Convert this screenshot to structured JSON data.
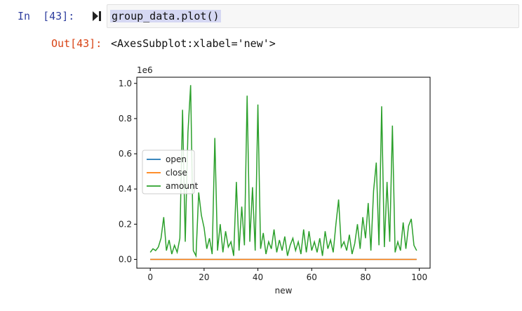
{
  "cell": {
    "in_prompt": "In  [43]:",
    "code": "group_data.plot()",
    "out_prompt": "Out[43]:",
    "output_text": "<AxesSubplot:xlabel='new'>"
  },
  "chart_data": {
    "type": "line",
    "xlabel": "new",
    "ylabel": "",
    "offset_label": "1e6",
    "xlim": [
      -5,
      104
    ],
    "ylim": [
      -0.05,
      1.035
    ],
    "x_ticks": [
      0,
      20,
      40,
      60,
      80,
      100
    ],
    "y_ticks": [
      0.0,
      0.2,
      0.4,
      0.6,
      0.8,
      1.0
    ],
    "x_tick_labels": [
      "0",
      "20",
      "40",
      "60",
      "80",
      "100"
    ],
    "y_tick_labels": [
      "0.0",
      "0.2",
      "0.4",
      "0.6",
      "0.8",
      "1.0"
    ],
    "legend_position": "center-left",
    "series": [
      {
        "name": "open",
        "color": "#1f77b4",
        "values": [
          0,
          0,
          0,
          0,
          0,
          0,
          0,
          0,
          0,
          0,
          0,
          0,
          0,
          0,
          0,
          0,
          0,
          0,
          0,
          0,
          0,
          0,
          0,
          0,
          0,
          0,
          0,
          0,
          0,
          0,
          0,
          0,
          0,
          0,
          0,
          0,
          0,
          0,
          0,
          0,
          0,
          0,
          0,
          0,
          0,
          0,
          0,
          0,
          0,
          0,
          0,
          0,
          0,
          0,
          0,
          0,
          0,
          0,
          0,
          0,
          0,
          0,
          0,
          0,
          0,
          0,
          0,
          0,
          0,
          0,
          0,
          0,
          0,
          0,
          0,
          0,
          0,
          0,
          0,
          0,
          0,
          0,
          0,
          0,
          0,
          0,
          0,
          0,
          0,
          0,
          0,
          0,
          0,
          0,
          0,
          0,
          0,
          0,
          0,
          0
        ]
      },
      {
        "name": "close",
        "color": "#ff7f0e",
        "values": [
          0,
          0,
          0,
          0,
          0,
          0,
          0,
          0,
          0,
          0,
          0,
          0,
          0,
          0,
          0,
          0,
          0,
          0,
          0,
          0,
          0,
          0,
          0,
          0,
          0,
          0,
          0,
          0,
          0,
          0,
          0,
          0,
          0,
          0,
          0,
          0,
          0,
          0,
          0,
          0,
          0,
          0,
          0,
          0,
          0,
          0,
          0,
          0,
          0,
          0,
          0,
          0,
          0,
          0,
          0,
          0,
          0,
          0,
          0,
          0,
          0,
          0,
          0,
          0,
          0,
          0,
          0,
          0,
          0,
          0,
          0,
          0,
          0,
          0,
          0,
          0,
          0,
          0,
          0,
          0,
          0,
          0,
          0,
          0,
          0,
          0,
          0,
          0,
          0,
          0,
          0,
          0,
          0,
          0,
          0,
          0,
          0,
          0,
          0,
          0
        ]
      },
      {
        "name": "amount",
        "color": "#2ca02c",
        "values": [
          0.04,
          0.06,
          0.05,
          0.07,
          0.12,
          0.24,
          0.05,
          0.11,
          0.03,
          0.08,
          0.04,
          0.12,
          0.85,
          0.1,
          0.72,
          0.99,
          0.05,
          0.02,
          0.38,
          0.25,
          0.18,
          0.06,
          0.12,
          0.03,
          0.69,
          0.05,
          0.2,
          0.04,
          0.16,
          0.07,
          0.1,
          0.02,
          0.44,
          0.05,
          0.3,
          0.08,
          0.93,
          0.1,
          0.41,
          0.05,
          0.88,
          0.06,
          0.15,
          0.03,
          0.1,
          0.06,
          0.17,
          0.04,
          0.11,
          0.05,
          0.13,
          0.02,
          0.08,
          0.12,
          0.05,
          0.1,
          0.03,
          0.17,
          0.04,
          0.16,
          0.05,
          0.1,
          0.04,
          0.12,
          0.02,
          0.16,
          0.06,
          0.11,
          0.04,
          0.2,
          0.34,
          0.07,
          0.1,
          0.05,
          0.14,
          0.03,
          0.09,
          0.2,
          0.06,
          0.24,
          0.12,
          0.32,
          0.05,
          0.39,
          0.55,
          0.08,
          0.87,
          0.07,
          0.44,
          0.1,
          0.76,
          0.04,
          0.1,
          0.05,
          0.21,
          0.06,
          0.19,
          0.23,
          0.08,
          0.05
        ]
      }
    ]
  }
}
